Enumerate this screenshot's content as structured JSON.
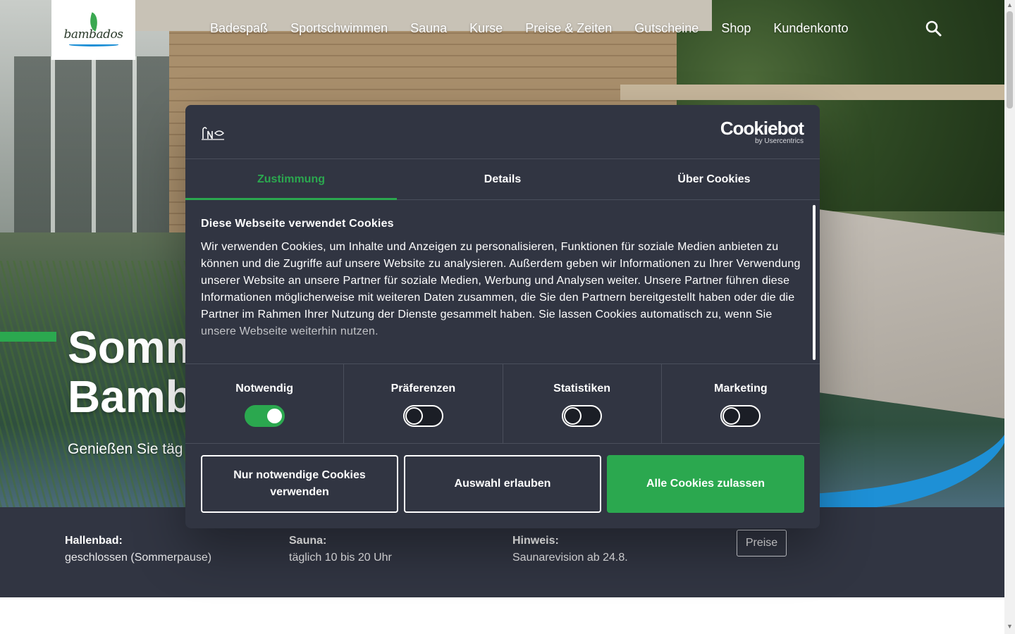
{
  "site": {
    "logo_text": "bambados",
    "nav": [
      "Badespaß",
      "Sportschwimmen",
      "Sauna",
      "Kurse",
      "Preise & Zeiten",
      "Gutscheine",
      "Shop",
      "Kundenkonto"
    ],
    "search_icon": "search-icon"
  },
  "hero": {
    "title_line1": "Somm",
    "title_line2": "Bamb",
    "subtitle": "Genießen Sie täg"
  },
  "info": {
    "items": [
      {
        "label": "Hallenbad:",
        "value": "geschlossen (Sommerpause)"
      },
      {
        "label": "Sauna:",
        "value": "täglich 10 bis 20 Uhr"
      },
      {
        "label": "Hinweis:",
        "value": "Saunarevision ab 24.8."
      }
    ],
    "button_label": "Preise"
  },
  "cookie": {
    "brand_title": "Cookiebot",
    "brand_subtitle": "by Usercentrics",
    "tabs": [
      {
        "label": "Zustimmung",
        "active": true
      },
      {
        "label": "Details",
        "active": false
      },
      {
        "label": "Über Cookies",
        "active": false
      }
    ],
    "heading": "Diese Webseite verwendet Cookies",
    "body": "Wir verwenden Cookies, um Inhalte und Anzeigen zu personalisieren, Funktionen für soziale Medien anbieten zu können und die Zugriffe auf unsere Website zu analysieren. Außerdem geben wir Informationen zu Ihrer Verwendung unserer Website an unsere Partner für soziale Medien, Werbung und Analysen weiter. Unsere Partner führen diese Informationen möglicherweise mit weiteren Daten zusammen, die Sie den Partnern bereitgestellt haben oder die die Partner im Rahmen Ihrer Nutzung der Dienste gesammelt haben. Sie lassen Cookies automatisch zu, wenn Sie unsere Webseite weiterhin nutzen.",
    "categories": [
      {
        "label": "Notwendig",
        "enabled": true
      },
      {
        "label": "Präferenzen",
        "enabled": false
      },
      {
        "label": "Statistiken",
        "enabled": false
      },
      {
        "label": "Marketing",
        "enabled": false
      }
    ],
    "buttons": {
      "necessary": "Nur notwendige Cookies verwenden",
      "selection": "Auswahl erlauben",
      "all": "Alle Cookies zulassen"
    }
  },
  "colors": {
    "accent_green": "#2ba84f",
    "dialog_bg": "#313542",
    "info_strip_bg": "#313542",
    "brand_blue": "#1e90d6"
  }
}
